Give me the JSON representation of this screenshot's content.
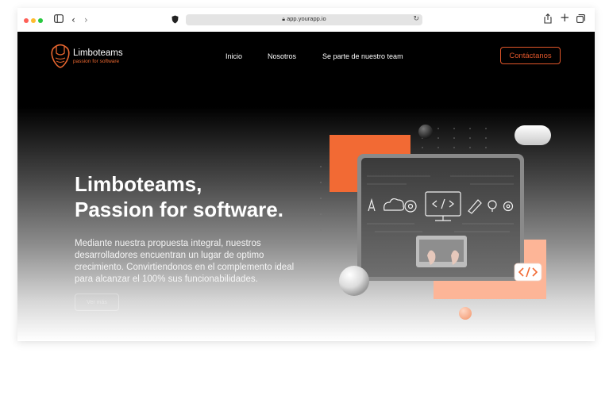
{
  "browser": {
    "url": "app.yourapp.io",
    "traffic_colors": [
      "#fe5f57",
      "#febc2e",
      "#28c840"
    ]
  },
  "brand": {
    "name": "Limboteams",
    "tagline": "passion for software",
    "accent": "#e8662f"
  },
  "nav": {
    "items": [
      "Inicio",
      "Nosotros",
      "Se parte de nuestro team"
    ],
    "contact_label": "Contáctanos"
  },
  "hero": {
    "title_line1": "Limboteams,",
    "title_line2": "Passion for software.",
    "description": "Mediante nuestra propuesta integral, nuestros desarrolladores encuentran un lugar de optimo crecimiento. Convirtiendonos en el complemento ideal para alcanzar el 100% sus funcionabilidades.",
    "cta_label": "Ver más"
  }
}
